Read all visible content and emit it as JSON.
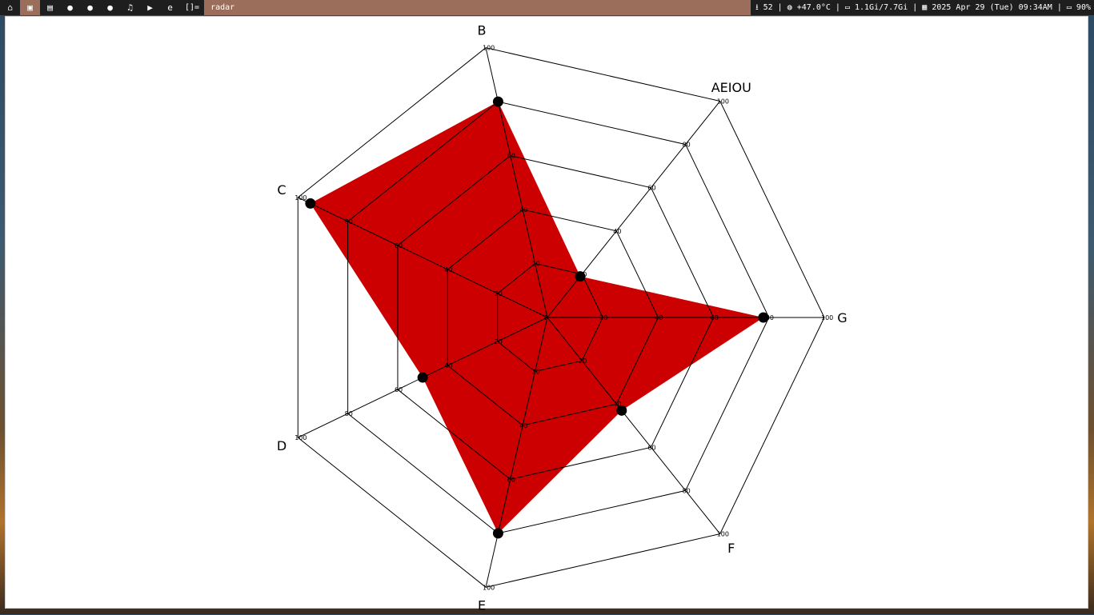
{
  "topbar": {
    "workspace_icons": [
      "home-icon",
      "terminal-icon",
      "document-icon",
      "help-icon",
      "help-icon",
      "help-icon",
      "music-icon",
      "play-icon",
      "browser-icon"
    ],
    "active_index": 1,
    "layout": "[]=",
    "window_title": "radar"
  },
  "status": {
    "text": "⭳ 52 | ◍ +47.0°C | ▭ 1.1Gi/7.7Gi | ▦ 2025 Apr 29 (Tue) 09:34AM | ▭ 90%"
  },
  "chart_data": {
    "type": "radar",
    "axes": [
      "G",
      "AEIOU",
      "B",
      "C",
      "D",
      "E",
      "F"
    ],
    "tick_values": [
      0,
      20,
      40,
      60,
      80,
      100
    ],
    "range": [
      0,
      100
    ],
    "series": [
      {
        "values": [
          78,
          19,
          80,
          95,
          50,
          80,
          43
        ]
      }
    ],
    "fill_color": "#cc0000",
    "marker_color": "#000000",
    "grid_color": "#000000",
    "grid": true
  }
}
